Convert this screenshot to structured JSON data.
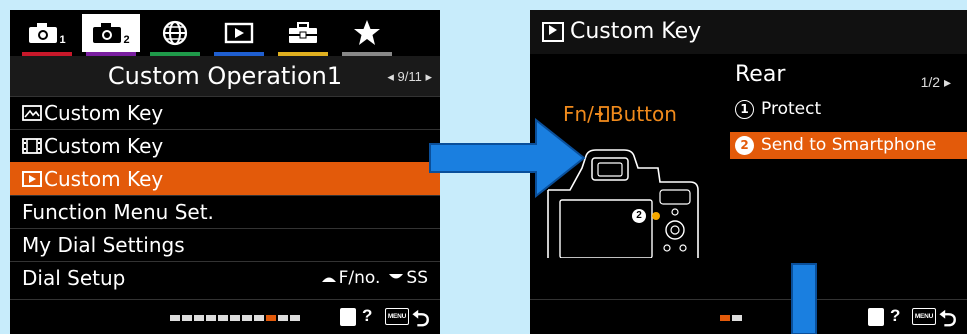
{
  "left_screen": {
    "tabs": [
      {
        "icon": "camera-icon",
        "sub": "1",
        "underline": "#c8182a",
        "selected": false
      },
      {
        "icon": "camera-icon",
        "sub": "2",
        "underline": "#7a1fa0",
        "selected": true
      },
      {
        "icon": "globe-icon",
        "underline": "#1f9a4a",
        "selected": false
      },
      {
        "icon": "playback-icon",
        "underline": "#1f5fd0",
        "selected": false
      },
      {
        "icon": "toolbox-icon",
        "underline": "#e0b020",
        "selected": false
      },
      {
        "icon": "star-icon",
        "underline": "#888888",
        "selected": false
      }
    ],
    "title": "Custom Operation1",
    "pager": "◂ 9/11 ▸",
    "menu_items": [
      {
        "icon": "photo-mode-icon",
        "label": "Custom Key"
      },
      {
        "icon": "movie-mode-icon",
        "label": "Custom Key"
      },
      {
        "icon": "playback-mode-icon",
        "label": "Custom Key",
        "selected": true
      },
      {
        "label": "Function Menu Set."
      },
      {
        "label": "My Dial Settings"
      },
      {
        "label": "Dial Setup",
        "value_front": "F/no.",
        "value_rear": "SS"
      }
    ],
    "page_count": 11,
    "current_page": 9,
    "help": "?",
    "menu_button_text": "MENU"
  },
  "right_screen": {
    "title": "Custom Key",
    "header": "Rear",
    "pager": "1/2 ▸",
    "button_label": "Fn/",
    "button_label_2": "Button",
    "options": [
      {
        "num": "1",
        "label": "Protect",
        "selected": false
      },
      {
        "num": "2",
        "label": "Send to Smartphone",
        "selected": true
      }
    ],
    "camera_marker": "2",
    "page_count": 2,
    "current_page": 1,
    "help": "?",
    "menu_button_text": "MENU"
  },
  "colors": {
    "accent": "#e35a0a",
    "fn_label": "#f08a1c",
    "background": "#c8ecfb",
    "arrow": "#1a7fe0"
  }
}
